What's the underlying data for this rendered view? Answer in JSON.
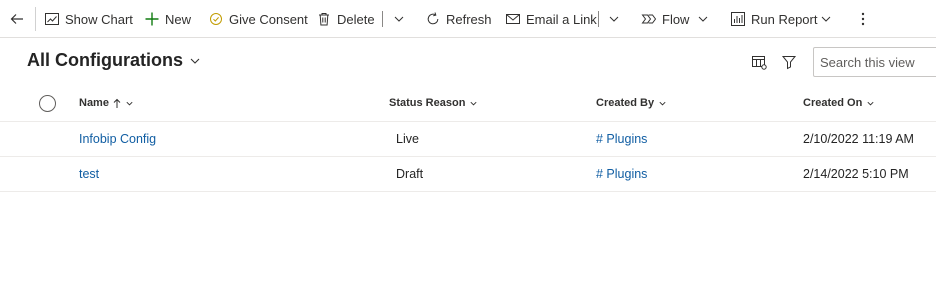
{
  "commandbar": {
    "show_chart": "Show Chart",
    "new": "New",
    "give_consent": "Give Consent",
    "delete": "Delete",
    "refresh": "Refresh",
    "email_link": "Email a Link",
    "flow": "Flow",
    "run_report": "Run Report"
  },
  "view": {
    "title": "All Configurations"
  },
  "search": {
    "placeholder": "Search this view"
  },
  "columns": [
    "Name",
    "Status Reason",
    "Created By",
    "Created On"
  ],
  "rows": [
    {
      "name": "Infobip Config",
      "status": "Live",
      "created_by": "# Plugins",
      "created_on": "2/10/2022 11:19 AM"
    },
    {
      "name": "test",
      "status": "Draft",
      "created_by": "# Plugins",
      "created_on": "2/14/2022 5:10 PM"
    }
  ],
  "colors": {
    "link": "#115ea3",
    "new_icon": "#107c10",
    "text": "#242424"
  }
}
